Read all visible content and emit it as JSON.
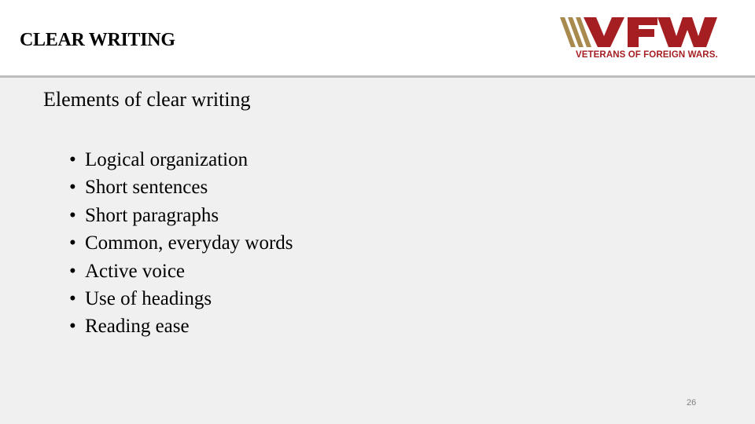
{
  "slide": {
    "title": "CLEAR WRITING",
    "subtitle": "Elements of clear writing",
    "bullet_glyph": "•",
    "bullets": [
      "Logical organization",
      "Short sentences",
      "Short paragraphs",
      "Common, everyday words",
      "Active voice",
      "Use of headings",
      "Reading ease"
    ],
    "page_number": "26"
  },
  "logo": {
    "letters": "VFW",
    "tagline": "VETERANS OF FOREIGN WARS.",
    "colors": {
      "red": "#a51e22",
      "gold": "#a88a4e"
    }
  }
}
